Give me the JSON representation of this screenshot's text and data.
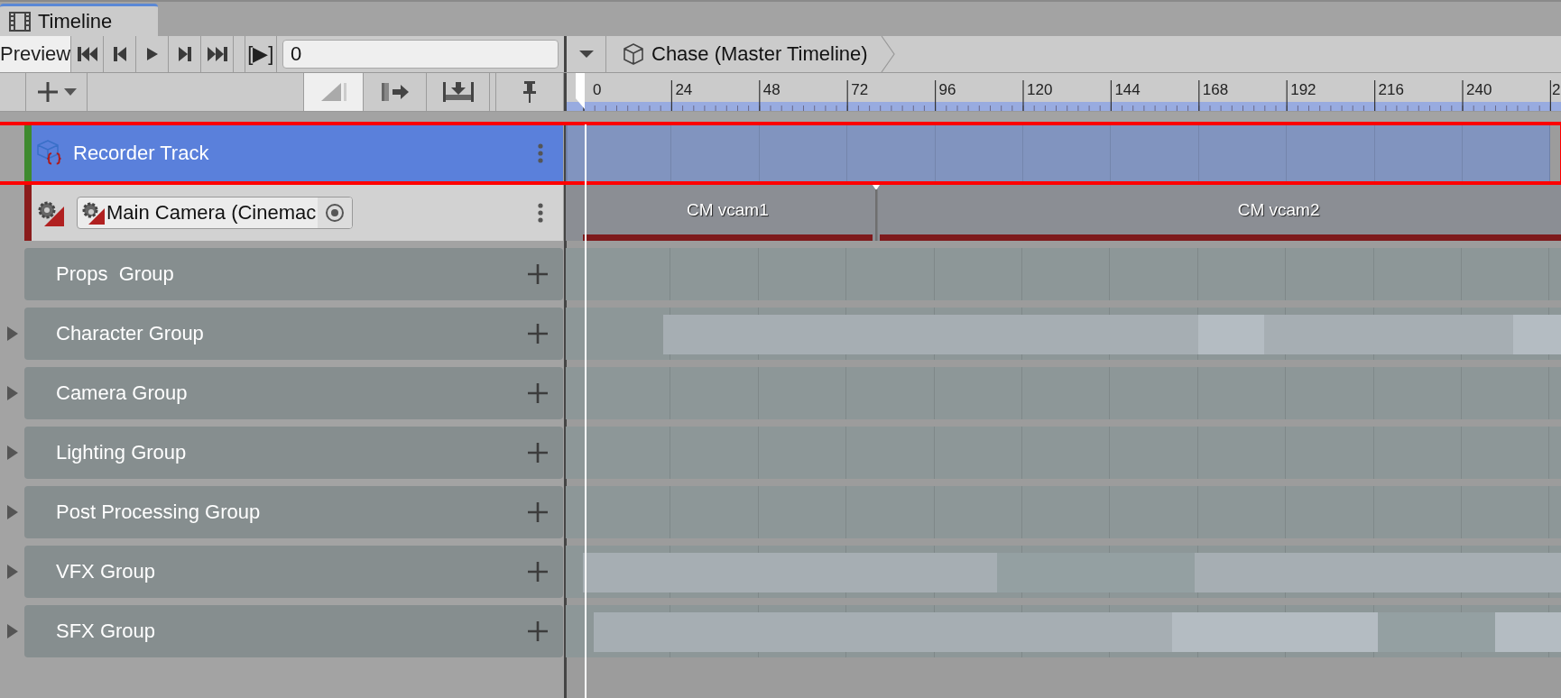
{
  "tab": {
    "title": "Timeline",
    "selected": true
  },
  "toolbar": {
    "preview": {
      "label": "Preview",
      "on": true
    },
    "transport": [
      {
        "kind": "first"
      },
      {
        "kind": "prev"
      },
      {
        "kind": "play"
      },
      {
        "kind": "next"
      },
      {
        "kind": "last"
      }
    ],
    "range_play": {
      "label": "[▶]",
      "on": false
    },
    "frame_field": {
      "value": "0"
    },
    "breadcrumb": {
      "title": "Chase (Master Timeline)"
    }
  },
  "ruler": {
    "labels": [
      "0",
      "24",
      "48",
      "72",
      "96",
      "120",
      "144",
      "168",
      "192",
      "216",
      "240",
      "2"
    ]
  },
  "tracks": [
    {
      "kind": "recorder",
      "name": "Recorder Track",
      "selected": true,
      "highlighted": true,
      "color": "#3e8a2e"
    },
    {
      "kind": "cinemachine",
      "binding": "Main Camera (Cinemac",
      "selected": false,
      "color": "#8a1c1c",
      "clips": [
        {
          "label": "CM vcam1"
        },
        {
          "label": "CM vcam2"
        }
      ]
    },
    {
      "kind": "group",
      "name": "Props  Group",
      "expandable": false
    },
    {
      "kind": "group",
      "name": "Character Group",
      "expandable": true
    },
    {
      "kind": "group",
      "name": "Camera Group",
      "expandable": true
    },
    {
      "kind": "group",
      "name": "Lighting Group",
      "expandable": true
    },
    {
      "kind": "group",
      "name": "Post Processing Group",
      "expandable": true
    },
    {
      "kind": "group",
      "name": "VFX Group",
      "expandable": true
    },
    {
      "kind": "group",
      "name": "SFX Group",
      "expandable": true
    }
  ]
}
